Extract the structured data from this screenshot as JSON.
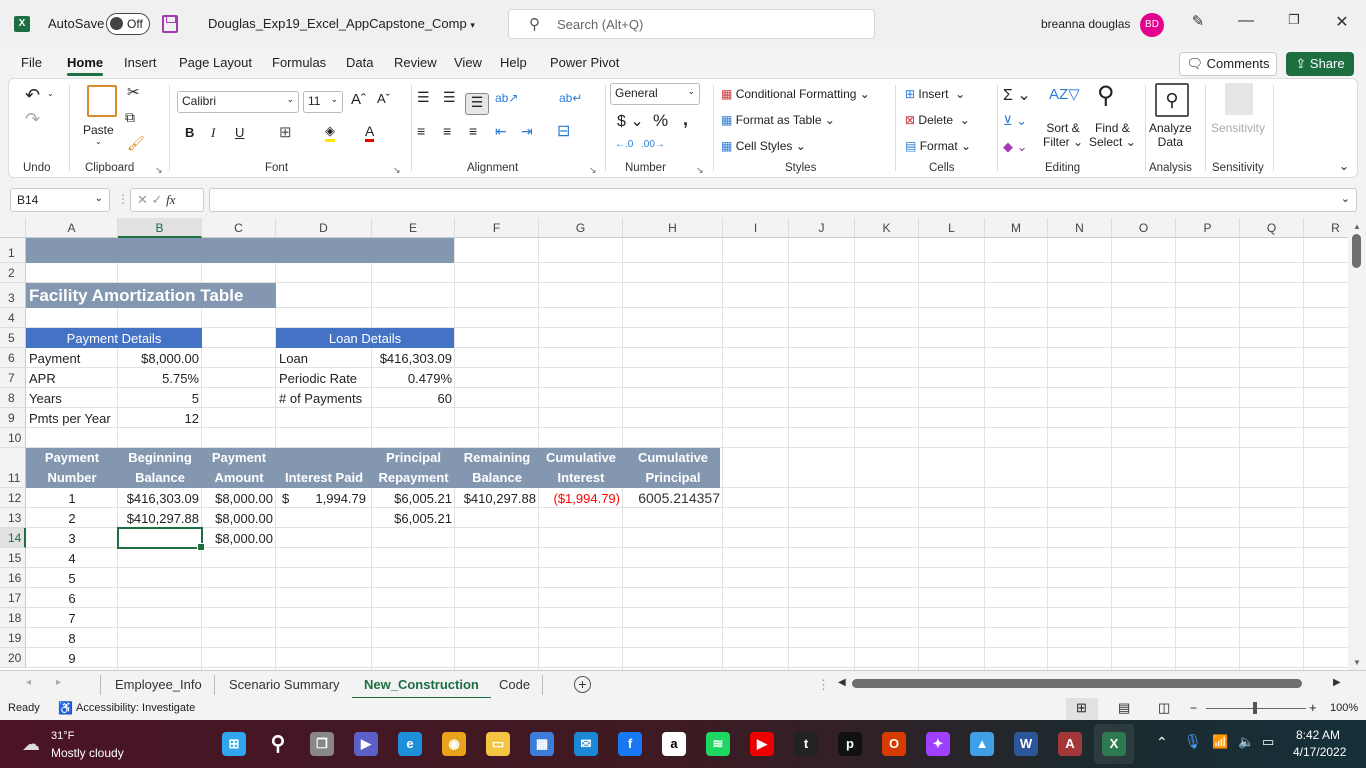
{
  "titlebar": {
    "app_icon": "excel-icon",
    "autosave_label": "AutoSave",
    "autosave_state": "Off",
    "document_title": "Douglas_Exp19_Excel_AppCapstone_Comp",
    "search_placeholder": "Search (Alt+Q)",
    "user_name": "breanna douglas",
    "user_initials": "BD",
    "minimize": "—",
    "restore": "❐",
    "close": "✕"
  },
  "menu": {
    "tabs": [
      "File",
      "Home",
      "Insert",
      "Page Layout",
      "Formulas",
      "Data",
      "Review",
      "View",
      "Help",
      "Power Pivot"
    ],
    "active_tab": "Home",
    "comments_label": "Comments",
    "share_label": "Share"
  },
  "ribbon": {
    "groups": {
      "undo": "Undo",
      "clipboard": "Clipboard",
      "font": "Font",
      "alignment": "Alignment",
      "number": "Number",
      "styles": "Styles",
      "cells": "Cells",
      "editing": "Editing",
      "analysis": "Analysis",
      "sensitivity": "Sensitivity"
    },
    "paste_label": "Paste",
    "font_name": "Calibri",
    "font_size": "11",
    "number_format": "General",
    "conditional_formatting": "Conditional Formatting",
    "format_as_table": "Format as Table",
    "cell_styles": "Cell Styles",
    "insert": "Insert",
    "delete": "Delete",
    "format": "Format",
    "sort_filter_1": "Sort &",
    "sort_filter_2": "Filter",
    "find_select_1": "Find &",
    "find_select_2": "Select",
    "analyze_data_1": "Analyze",
    "analyze_data_2": "Data",
    "sensitivity_btn": "Sensitivity"
  },
  "formula_bar": {
    "name_box": "B14",
    "fx": "fx",
    "formula": ""
  },
  "columns": [
    "A",
    "B",
    "C",
    "D",
    "E",
    "F",
    "G",
    "H",
    "I",
    "J",
    "K",
    "L",
    "M",
    "N",
    "O",
    "P",
    "Q",
    "R"
  ],
  "selected_column": "B",
  "rows": [
    "1",
    "2",
    "3",
    "4",
    "5",
    "6",
    "7",
    "8",
    "9",
    "10",
    "11",
    "12",
    "13",
    "14",
    "15",
    "16",
    "17",
    "18",
    "19",
    "20"
  ],
  "selected_row": "14",
  "sheet": {
    "title": "Facility Amortization Table",
    "payment_details": {
      "header": "Payment Details",
      "rows": [
        {
          "label": "Payment",
          "value": "$8,000.00"
        },
        {
          "label": "APR",
          "value": "5.75%"
        },
        {
          "label": "Years",
          "value": "5"
        },
        {
          "label": "Pmts per Year",
          "value": "12"
        }
      ]
    },
    "loan_details": {
      "header": "Loan Details",
      "rows": [
        {
          "label": "Loan",
          "value": "$416,303.09"
        },
        {
          "label": "Periodic Rate",
          "value": "0.479%"
        },
        {
          "label": "# of Payments",
          "value": "60"
        }
      ]
    },
    "table_headers": [
      [
        "Payment",
        "Number"
      ],
      [
        "Beginning",
        "Balance"
      ],
      [
        "Payment",
        "Amount"
      ],
      [
        "",
        "Interest Paid"
      ],
      [
        "Principal",
        "Repayment"
      ],
      [
        "Remaining",
        "Balance"
      ],
      [
        "Cumulative",
        "Interest"
      ],
      [
        "Cumulative",
        "Principal"
      ]
    ],
    "table_rows": [
      [
        "1",
        "$416,303.09",
        "$8,000.00",
        "$",
        "1,994.79",
        "$6,005.21",
        "$410,297.88",
        "($1,994.79)",
        "6005.214357"
      ],
      [
        "2",
        "$410,297.88",
        "$8,000.00",
        "",
        "",
        "$6,005.21",
        "",
        "",
        ""
      ],
      [
        "3",
        "",
        "$8,000.00",
        "",
        "",
        "",
        "",
        "",
        ""
      ],
      [
        "4",
        "",
        "",
        "",
        "",
        "",
        "",
        "",
        ""
      ],
      [
        "5",
        "",
        "",
        "",
        "",
        "",
        "",
        "",
        ""
      ],
      [
        "6",
        "",
        "",
        "",
        "",
        "",
        "",
        "",
        ""
      ],
      [
        "7",
        "",
        "",
        "",
        "",
        "",
        "",
        "",
        ""
      ],
      [
        "8",
        "",
        "",
        "",
        "",
        "",
        "",
        "",
        ""
      ],
      [
        "9",
        "",
        "",
        "",
        "",
        "",
        "",
        "",
        ""
      ]
    ],
    "colors": {
      "title_band": "#8497b0",
      "section_header": "#4472c4",
      "negative": "#ff0000",
      "selection": "#1d6f42"
    }
  },
  "sheet_tabs": {
    "tabs": [
      "Employee_Info",
      "Scenario Summary",
      "New_Construction",
      "Code"
    ],
    "active": "New_Construction",
    "add_icon": "+"
  },
  "status_bar": {
    "ready": "Ready",
    "accessibility": "Accessibility: Investigate",
    "zoom": "100%",
    "zoom_minus": "−",
    "zoom_plus": "+"
  },
  "taskbar": {
    "weather_temp": "31°F",
    "weather_desc": "Mostly cloudy",
    "time": "8:42 AM",
    "date": "4/17/2022",
    "apps": [
      "start",
      "search",
      "task-view",
      "teams",
      "edge",
      "chrome",
      "file-explorer",
      "store",
      "mail",
      "facebook",
      "amazon",
      "spotify",
      "youtube",
      "tubi",
      "pluto-tv",
      "office",
      "messenger",
      "photos",
      "word",
      "access",
      "excel"
    ]
  }
}
